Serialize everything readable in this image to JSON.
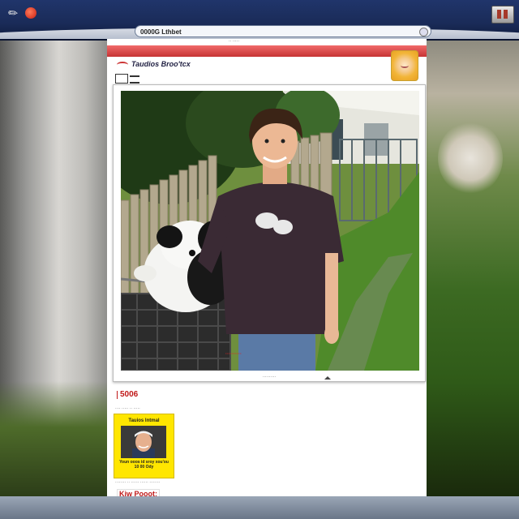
{
  "address_bar": {
    "text": "0000G Lthbet"
  },
  "page": {
    "caption_top": "·· ·····",
    "site_logo": "Taudios Broo'tcx",
    "photo_caption": "··········",
    "photo_tag": "··········",
    "count": "5006",
    "small_line_1": "···· ····· ·· ·····",
    "card": {
      "title": "Tauios Intmal",
      "text": "Youn ooos id sroy xou'ou 10 00 Ody"
    },
    "small_line_2": "········ ·· ······ ······ ········",
    "footer_link": "Kiw Pooot:"
  },
  "colors": {
    "topbar": "#1a2b58",
    "redbar": "#d94444",
    "card": "#ffe600",
    "accent_red": "#c01818"
  },
  "icons": [
    "pen-icon",
    "record-icon",
    "window-icon",
    "avatar-icon",
    "caret-icon"
  ]
}
